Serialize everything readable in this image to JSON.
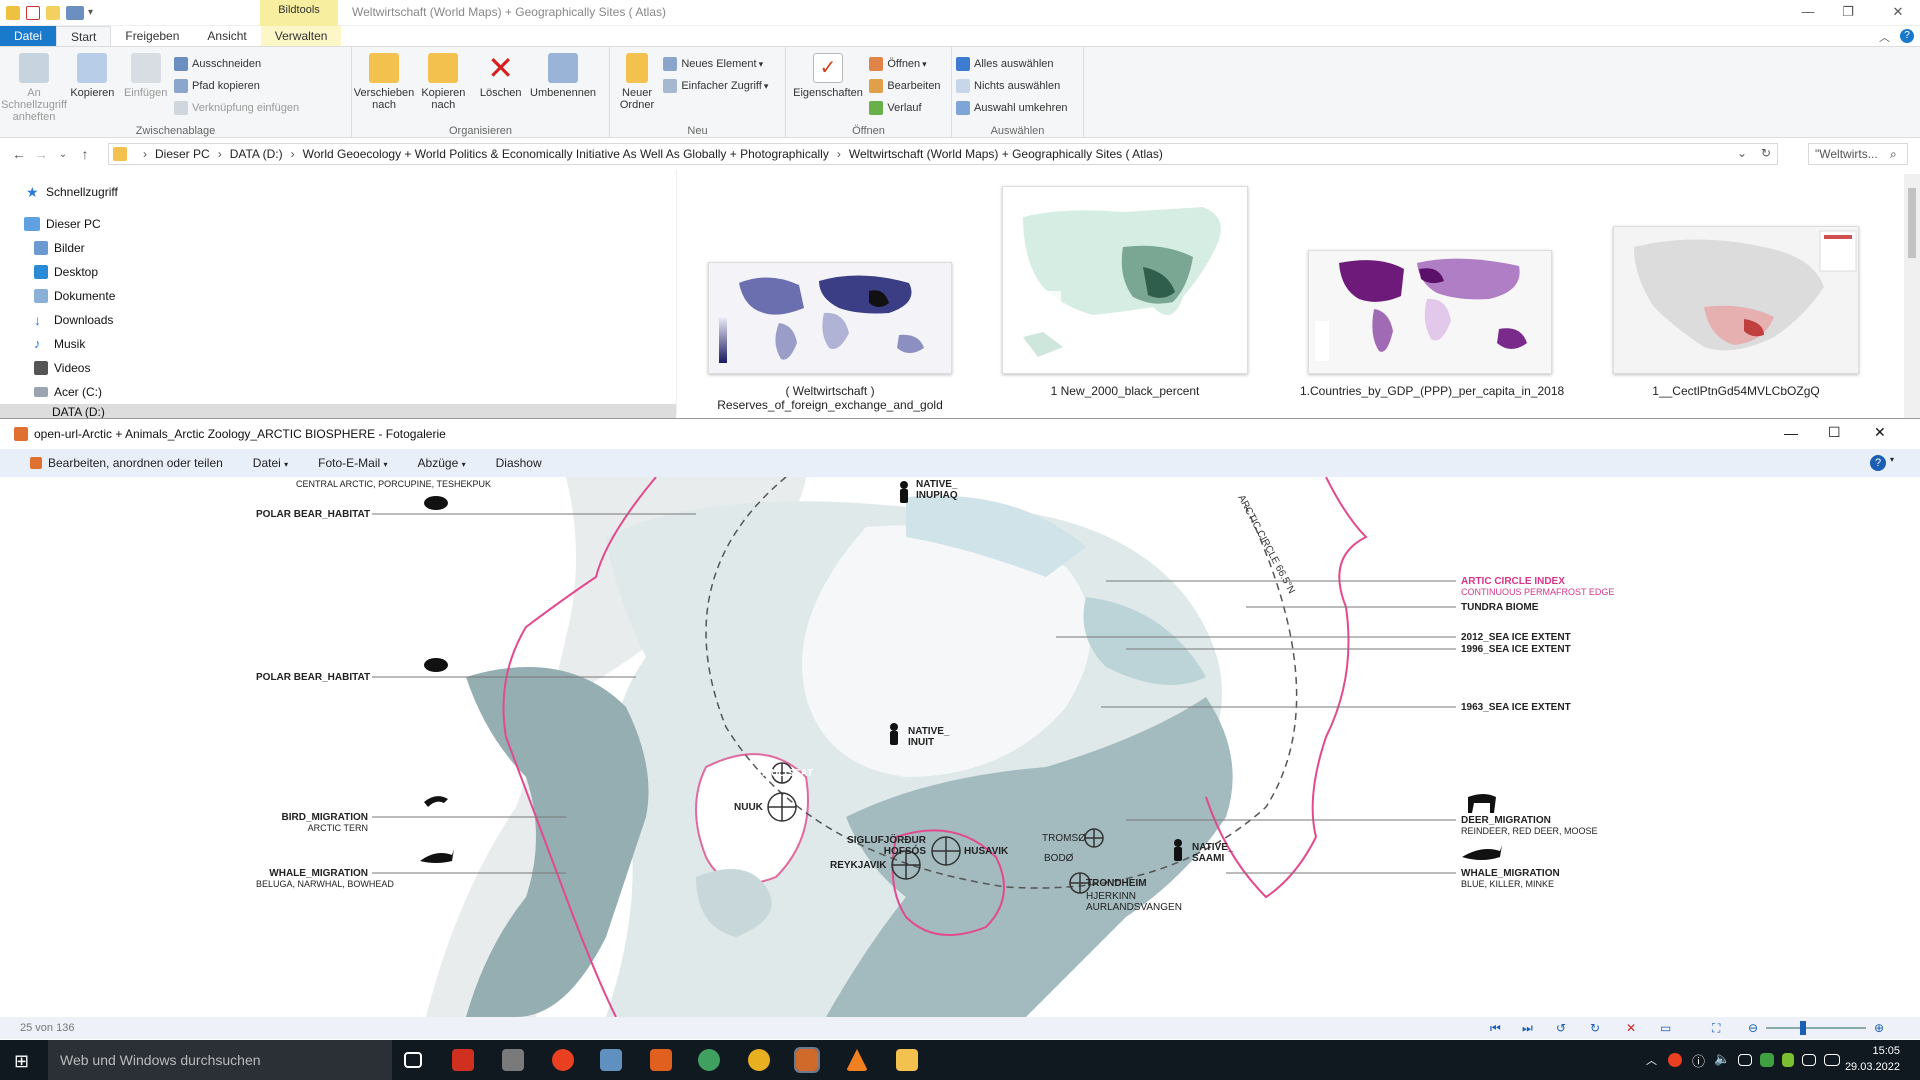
{
  "explorer": {
    "context_tab": "Bildtools",
    "window_title": "Weltwirtschaft (World Maps) + Geographically Sites ( Atlas)",
    "tabs": [
      "Datei",
      "Start",
      "Freigeben",
      "Ansicht",
      "Verwalten"
    ],
    "ribbon": {
      "clipboard": {
        "title": "Zwischenablage",
        "pin_label": "An Schnellzugriff anheften",
        "copy_label": "Kopieren",
        "paste_label": "Einfügen",
        "cut_label": "Ausschneiden",
        "copy_path_label": "Pfad kopieren",
        "paste_shortcut_label": "Verknüpfung einfügen"
      },
      "organize": {
        "title": "Organisieren",
        "move_label": "Verschieben nach",
        "copyto_label": "Kopieren nach",
        "delete_label": "Löschen",
        "rename_label": "Umbenennen"
      },
      "new": {
        "title": "Neu",
        "newfolder_label": "Neuer Ordner",
        "newitem_label": "Neues Element",
        "easyaccess_label": "Einfacher Zugriff"
      },
      "open": {
        "title": "Öffnen",
        "properties_label": "Eigenschaften",
        "open_label": "Öffnen",
        "edit_label": "Bearbeiten",
        "history_label": "Verlauf"
      },
      "select": {
        "title": "Auswählen",
        "selectall_label": "Alles auswählen",
        "selectnone_label": "Nichts auswählen",
        "invert_label": "Auswahl umkehren"
      }
    },
    "address": [
      "Dieser PC",
      "DATA (D:)",
      "World Geoecology + World Politics & Economically Initiative As Well As Globally + Photographically",
      "Weltwirtschaft (World Maps) + Geographically Sites ( Atlas)"
    ],
    "search_placeholder": "\"Weltwirts...",
    "nav": {
      "quick": "Schnellzugriff",
      "pc": "Dieser PC",
      "items": [
        "Bilder",
        "Desktop",
        "Dokumente",
        "Downloads",
        "Musik",
        "Videos",
        "Acer (C:)",
        "DATA (D:)"
      ]
    },
    "files": [
      {
        "name": "( Weltwirtschaft ) Reserves_of_foreign_exchange_and_gold"
      },
      {
        "name": "1 New_2000_black_percent"
      },
      {
        "name": "1.Countries_by_GDP_(PPP)_per_capita_in_2018"
      },
      {
        "name": "1__CectlPtnGd54MVLCbOZgQ"
      }
    ]
  },
  "gallery": {
    "title": "open-url-Arctic + Animals_Arctic Zoology_ARCTIC BIOSPHERE - Fotogalerie",
    "toolbar": [
      "Bearbeiten, anordnen oder teilen",
      "Datei",
      "Foto-E-Mail",
      "Abzüge",
      "Diashow"
    ],
    "status": "25 von 136",
    "map": {
      "arc_label": "ARCTIC CIRCLE 66.5°N",
      "left": [
        {
          "title": "",
          "sub": "CENTRAL ARCTIC, PORCUPINE, TESHEKPUK"
        },
        {
          "title": "POLAR BEAR_HABITAT",
          "sub": ""
        },
        {
          "title": "POLAR BEAR_HABITAT",
          "sub": ""
        },
        {
          "title": "BIRD_MIGRATION",
          "sub": "ARCTIC TERN"
        },
        {
          "title": "WHALE_MIGRATION",
          "sub": "BELUGA, NARWHAL, BOWHEAD"
        }
      ],
      "right": [
        {
          "title": "ARTIC CIRCLE INDEX",
          "sub": "CONTINUOUS PERMAFROST EDGE"
        },
        {
          "title": "TUNDRA BIOME",
          "sub": ""
        },
        {
          "title": "2012_SEA ICE EXTENT",
          "sub": ""
        },
        {
          "title": "1996_SEA ICE EXTENT",
          "sub": ""
        },
        {
          "title": "1963_SEA ICE EXTENT",
          "sub": ""
        },
        {
          "title": "DEER_MIGRATION",
          "sub": "REINDEER, RED DEER, MOOSE"
        },
        {
          "title": "WHALE_MIGRATION",
          "sub": "BLUE, KILLER, MINKE"
        }
      ],
      "places": [
        "NATIVE_ INUPIAQ",
        "NATIVE_ INUIT",
        "NATIVE_ SAAMI",
        "ILULISSAT",
        "NUUK",
        "SIGLUFJÖRÐUR HOFSÓS",
        "HUSAVIK",
        "REYKJAVIK",
        "TROMSØ",
        "BODØ",
        "TRONDHEIM",
        "HJERKINN AURLANDSVANGEN"
      ]
    }
  },
  "taskbar": {
    "search": "Web und Windows durchsuchen",
    "time": "15:05",
    "date": "29.03.2022"
  }
}
